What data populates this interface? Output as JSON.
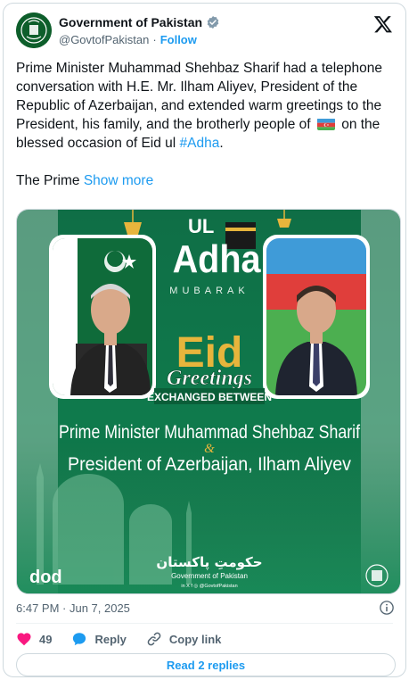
{
  "header": {
    "display_name": "Government of Pakistan",
    "handle": "@GovtofPakistan",
    "separator": "·",
    "follow_label": "Follow"
  },
  "tweet": {
    "text_part1": "Prime Minister Muhammad Shehbaz Sharif had a telephone conversation with H.E. Mr. Ilham Aliyev, President of the Republic of Azerbaijan, and extended warm greetings to the President, his family, and the brotherly people of",
    "text_part2": "on the blessed occasion of Eid ul",
    "hashtag": "#Adha",
    "text_part3": ".",
    "truncated_text": "The Prime",
    "show_more_label": "Show more"
  },
  "media": {
    "top_words": [
      "UL",
      "Adha"
    ],
    "mubarak": "MUBARAK",
    "eid": "Eid",
    "greetings": "Greetings",
    "exchanged": "EXCHANGED BETWEEN",
    "line1": "Prime Minister Muhammad Shehbaz Sharif",
    "ampersand": "&",
    "line2": "President of Azerbaijan, Ilham Aliyev",
    "footer_urdu": "حکومتِ پاکستان",
    "footer_english": "Government of Pakistan",
    "footer_social": "in  X  f  ◎  @GovtofPakistan",
    "footer_logo_text": "dod",
    "colors": {
      "pakistan_green": "#01411c",
      "teal_bg": "#0e7a52",
      "gold": "#e7b53c",
      "az_blue": "#3f9bd8",
      "az_red": "#e03e3b",
      "az_green": "#4caf50"
    }
  },
  "meta": {
    "timestamp": "6:47 PM · Jun 7, 2025"
  },
  "actions": {
    "likes_count": "49",
    "reply_label": "Reply",
    "copy_link_label": "Copy link"
  },
  "replies": {
    "read_replies_label": "Read 2 replies"
  },
  "icons": [
    "verified-badge-icon",
    "x-logo-icon",
    "azerbaijan-flag-icon",
    "info-icon",
    "heart-icon",
    "reply-icon",
    "link-icon"
  ]
}
